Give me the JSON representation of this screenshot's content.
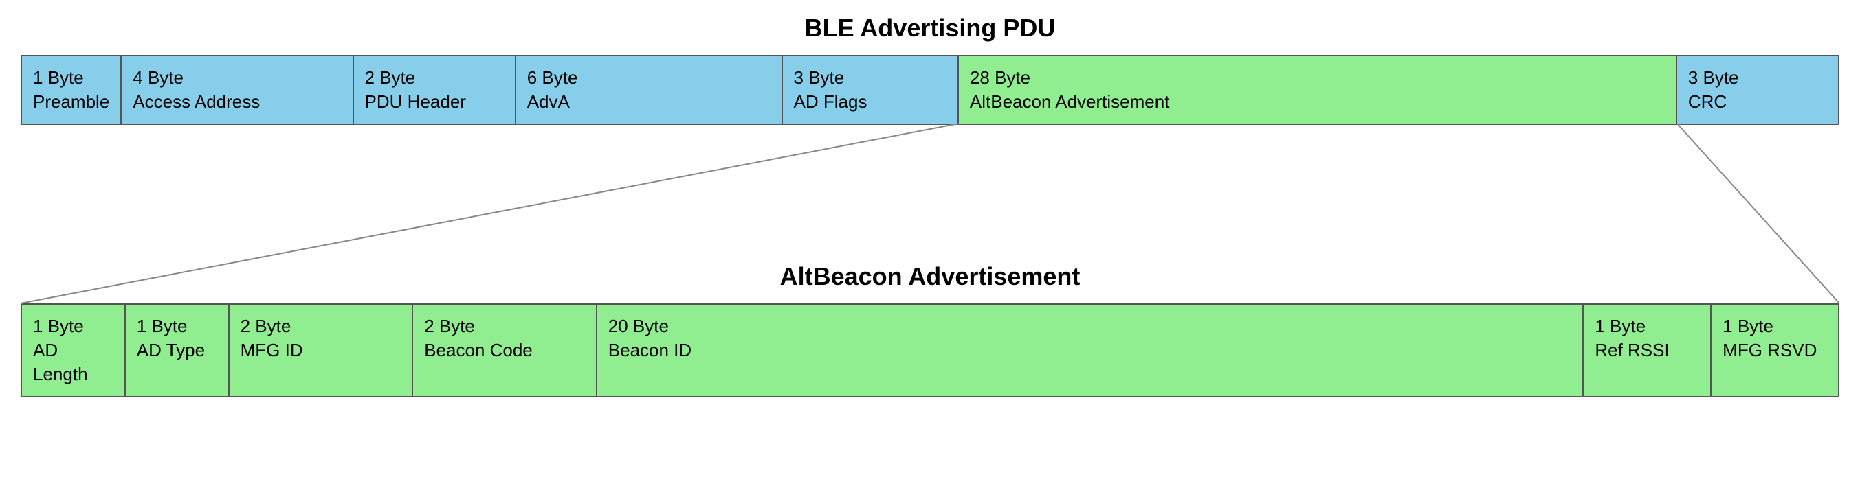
{
  "ble_title": "BLE Advertising PDU",
  "alt_title": "AltBeacon Advertisement",
  "ble_cells": [
    {
      "label": "1 Byte\nPreamble",
      "class": "blue ble-preamble",
      "name": "ble-preamble"
    },
    {
      "label": "4 Byte\nAccess Address",
      "class": "blue ble-access",
      "name": "ble-access-address"
    },
    {
      "label": "2 Byte\nPDU Header",
      "class": "blue ble-pdu",
      "name": "ble-pdu-header"
    },
    {
      "label": "6 Byte\nAdvA",
      "class": "blue ble-adva",
      "name": "ble-adva"
    },
    {
      "label": "3 Byte\nAD Flags",
      "class": "blue ble-adflags",
      "name": "ble-ad-flags"
    },
    {
      "label": "28 Byte\nAltBeacon Advertisement",
      "class": "green ble-altbeacon",
      "name": "ble-altbeacon"
    },
    {
      "label": "3 Byte\nCRC",
      "class": "blue ble-crc",
      "name": "ble-crc"
    }
  ],
  "alt_cells": [
    {
      "label": "1 Byte\nAD Length",
      "class": "green alt-adlen",
      "name": "alt-ad-length"
    },
    {
      "label": "1 Byte\nAD Type",
      "class": "green alt-adtype",
      "name": "alt-ad-type"
    },
    {
      "label": "2 Byte\nMFG ID",
      "class": "green alt-mfgid",
      "name": "alt-mfg-id"
    },
    {
      "label": "2 Byte\nBeacon Code",
      "class": "green alt-beaconcode",
      "name": "alt-beacon-code"
    },
    {
      "label": "20 Byte\nBeacon ID",
      "class": "green alt-beaconid",
      "name": "alt-beacon-id"
    },
    {
      "label": "1 Byte\nRef RSSI",
      "class": "green alt-refrssi",
      "name": "alt-ref-rssi"
    },
    {
      "label": "1 Byte\nMFG RSVD",
      "class": "green alt-mfgrsvd",
      "name": "alt-mfg-rsvd"
    }
  ]
}
